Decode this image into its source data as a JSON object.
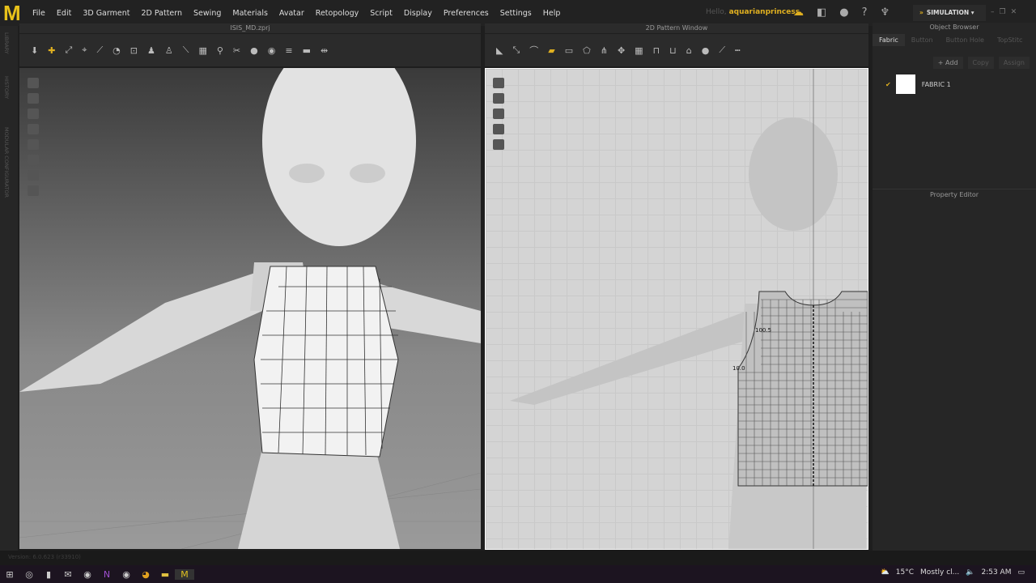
{
  "app": {
    "logo": "M",
    "menu": [
      "File",
      "Edit",
      "3D Garment",
      "2D Pattern",
      "Sewing",
      "Materials",
      "Avatar",
      "Retopology",
      "Script",
      "Display",
      "Preferences",
      "Settings",
      "Help"
    ],
    "hello_prefix": "Hello,",
    "username": "aquarianprincess",
    "mode": "SIMULATION"
  },
  "left_strip": [
    "LIBRARY",
    "HISTORY",
    "MODULAR CONFIGURATOR"
  ],
  "view3d": {
    "title": "ISIS_MD.zprj"
  },
  "view2d": {
    "title": "2D Pattern Window",
    "measure_a": "100.5",
    "measure_b": "10.0"
  },
  "object_browser": {
    "title": "Object Browser",
    "tabs": [
      "Fabric",
      "Button",
      "Button Hole",
      "TopStitc"
    ],
    "buttons": [
      "+ Add",
      "Copy",
      "Assign"
    ],
    "fabrics": [
      {
        "name": "FABRIC 1",
        "color": "#ffffff"
      }
    ]
  },
  "property_editor": {
    "title": "Property Editor"
  },
  "status": {
    "version": "Version: 6.0.623 (r33910)"
  },
  "taskbar": {
    "weather": "15°C",
    "weather_desc": "Mostly cl...",
    "time": "2:53 AM"
  }
}
